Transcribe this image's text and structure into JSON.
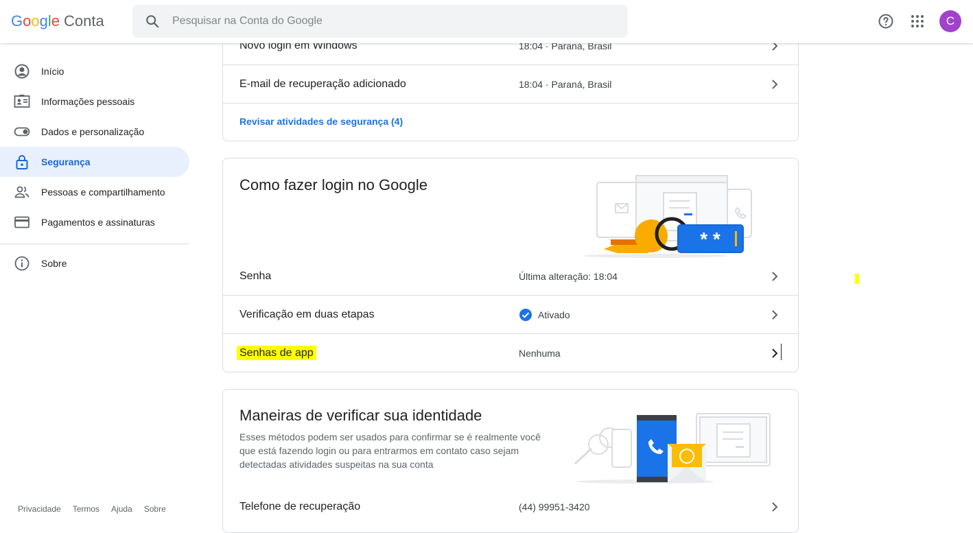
{
  "header": {
    "logo_word": "Google",
    "product_name": "Conta",
    "search_placeholder": "Pesquisar na Conta do Google",
    "avatar_letter": "C",
    "avatar_color": "#a142cc"
  },
  "sidebar": {
    "items": [
      {
        "label": "Início",
        "icon": "account-circle-icon"
      },
      {
        "label": "Informações pessoais",
        "icon": "id-card-icon"
      },
      {
        "label": "Dados e personalização",
        "icon": "toggle-icon"
      },
      {
        "label": "Segurança",
        "icon": "lock-icon",
        "active": true
      },
      {
        "label": "Pessoas e compartilhamento",
        "icon": "people-icon"
      },
      {
        "label": "Pagamentos e assinaturas",
        "icon": "credit-card-icon"
      },
      {
        "label": "Sobre",
        "icon": "info-icon"
      }
    ],
    "footer": [
      "Privacidade",
      "Termos",
      "Ajuda",
      "Sobre"
    ]
  },
  "activity_card": {
    "rows": [
      {
        "label": "Novo login em Windows",
        "value": "18:04 · Paraná, Brasil"
      },
      {
        "label": "E-mail de recuperação adicionado",
        "value": "18:04 · Paraná, Brasil"
      }
    ],
    "review_link": "Revisar atividades de segurança (4)"
  },
  "signin_card": {
    "title": "Como fazer login no Google",
    "illustration_password": "* *",
    "rows": [
      {
        "label": "Senha",
        "value": "Última alteração: 18:04"
      },
      {
        "label": "Verificação em duas etapas",
        "value": "Ativado"
      },
      {
        "label": "Senhas de app",
        "value": "Nenhuma"
      }
    ]
  },
  "verify_card": {
    "title": "Maneiras de verificar sua identidade",
    "description": "Esses métodos podem ser usados para confirmar se é realmente você que está fazendo login ou para entrarmos em contato caso sejam detectadas atividades suspeitas na sua conta",
    "rows": [
      {
        "label": "Telefone de recuperação",
        "value": "(44) 99951-3420"
      }
    ]
  },
  "colors": {
    "accent": "#1a73e8",
    "active_bg": "#e8f0fe",
    "highlight": "#ffff00"
  }
}
